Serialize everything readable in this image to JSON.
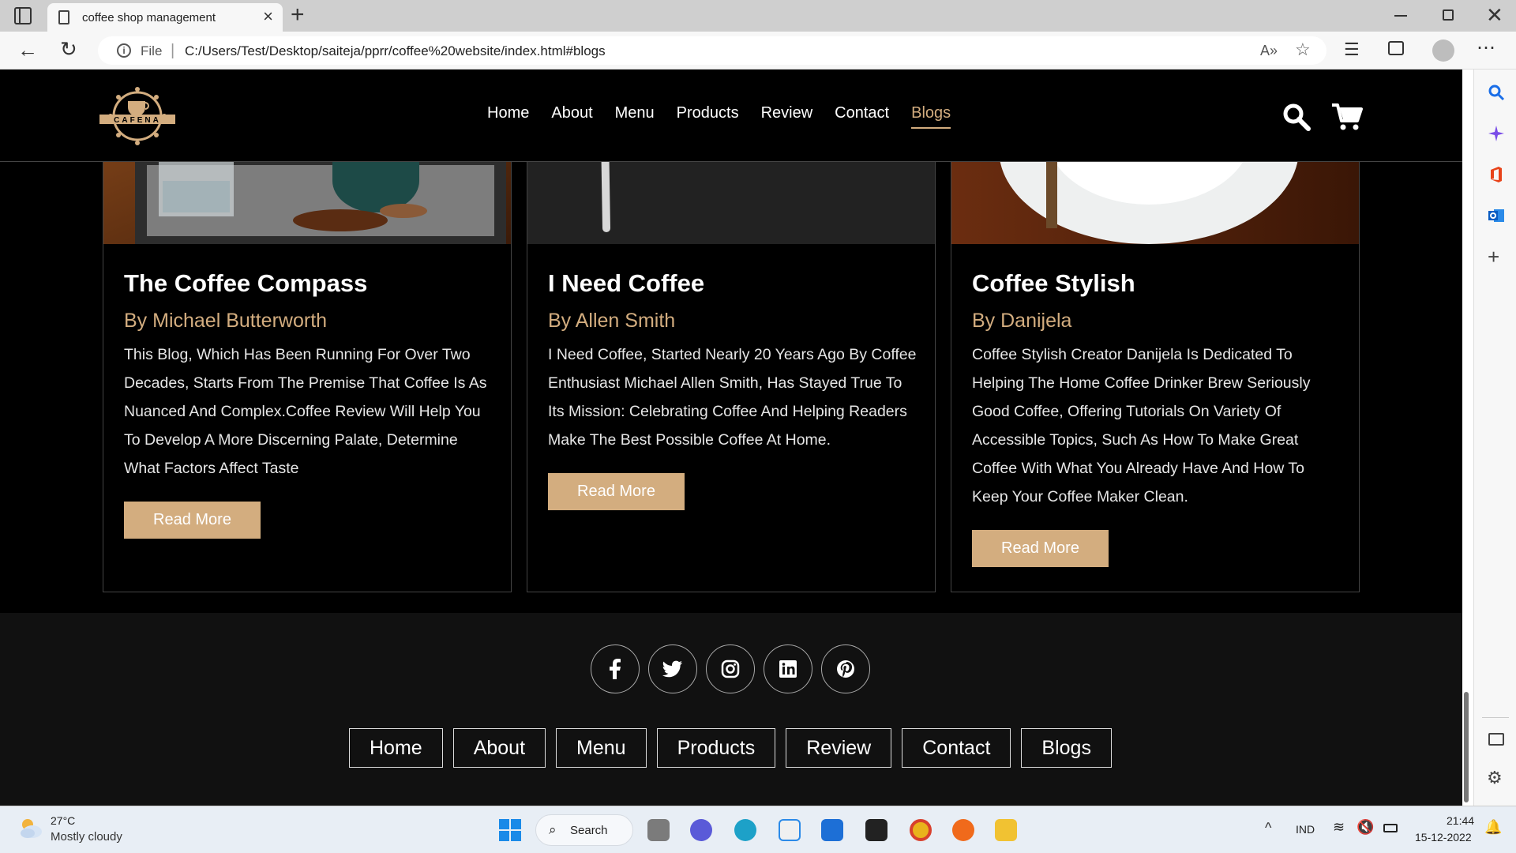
{
  "browser": {
    "tab_title": "coffee shop management",
    "url_label": "File",
    "url": "C:/Users/Test/Desktop/saiteja/pprr/coffee%20website/index.html#blogs"
  },
  "site": {
    "logo_text": "CAFENA",
    "nav": [
      "Home",
      "About",
      "Menu",
      "Products",
      "Review",
      "Contact",
      "Blogs"
    ],
    "active_nav": "Blogs"
  },
  "blogs": [
    {
      "title": "The Coffee Compass",
      "author": "By Michael Butterworth",
      "text": "This Blog, Which Has Been Running For Over Two Decades, Starts From The Premise That Coffee Is As Nuanced And Complex.Coffee Review Will Help You To Develop A More Discerning Palate, Determine What Factors Affect Taste",
      "button": "Read More"
    },
    {
      "title": "I Need Coffee",
      "author": "By Allen Smith",
      "text": "I Need Coffee, Started Nearly 20 Years Ago By Coffee Enthusiast Michael Allen Smith, Has Stayed True To Its Mission: Celebrating Coffee And Helping Readers Make The Best Possible Coffee At Home.",
      "button": "Read More"
    },
    {
      "title": "Coffee Stylish",
      "author": "By Danijela",
      "text": "Coffee Stylish Creator Danijela Is Dedicated To Helping The Home Coffee Drinker Brew Seriously Good Coffee, Offering Tutorials On Variety Of Accessible Topics, Such As How To Make Great Coffee With What You Already Have And How To Keep Your Coffee Maker Clean.",
      "button": "Read More"
    }
  ],
  "footer": {
    "social_icons": [
      "facebook-icon",
      "twitter-icon",
      "instagram-icon",
      "linkedin-icon",
      "pinterest-icon"
    ],
    "links": [
      "Home",
      "About",
      "Menu",
      "Products",
      "Review",
      "Contact",
      "Blogs"
    ]
  },
  "taskbar": {
    "temperature": "27°C",
    "weather": "Mostly cloudy",
    "search_label": "Search",
    "language": "IND",
    "time": "21:44",
    "date": "15-12-2022"
  },
  "colors": {
    "accent": "#d3ad7f",
    "background": "#000000",
    "footer_bg": "#111111"
  }
}
